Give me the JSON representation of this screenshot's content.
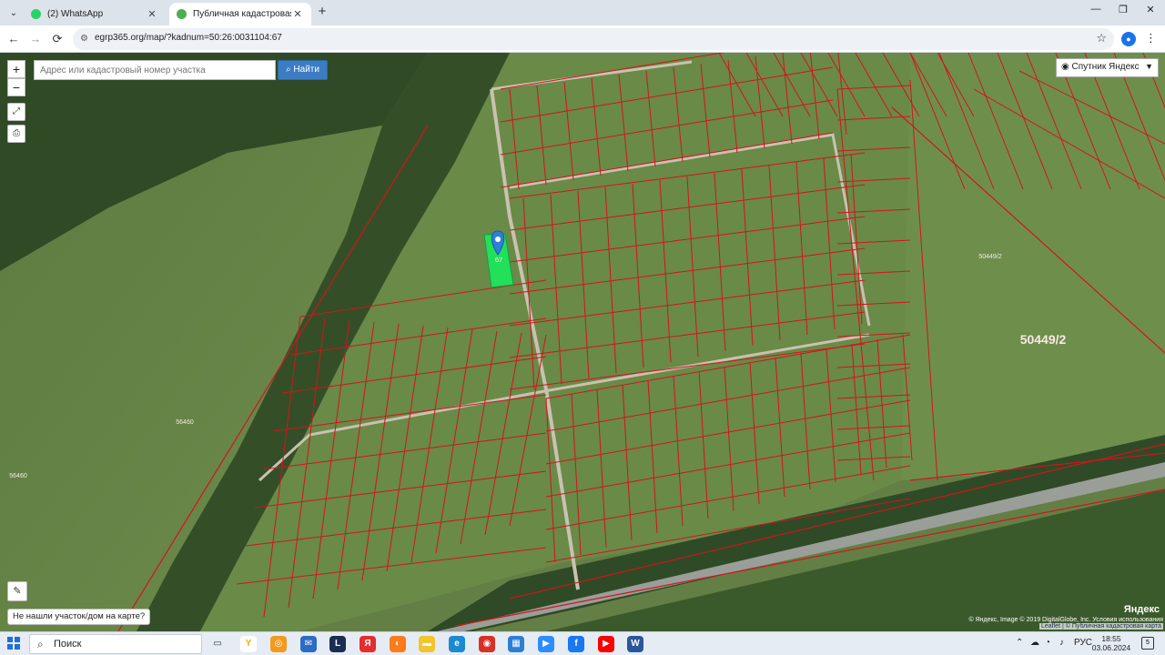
{
  "browser": {
    "tabs": [
      {
        "title": "(2) WhatsApp",
        "icon": "whatsapp-icon",
        "close": "✕"
      },
      {
        "title": "Публичная кадастровая карта",
        "icon": "site-favicon-icon",
        "close": "✕"
      }
    ],
    "new_tab": "+",
    "window": {
      "minimize": "—",
      "restore": "❐",
      "close": "✕"
    },
    "url": "egrp365.org/map/?kadnum=50:26:0031104:67",
    "nav": {
      "back": "←",
      "forward": "→",
      "reload": "⟳"
    }
  },
  "map": {
    "search_placeholder": "Адрес или кадастровый номер участка",
    "find_label": "Найти",
    "layer_select": "Спутник Яндекс",
    "zoom_in": "+",
    "zoom_out": "−",
    "not_found": "Не нашли участок/дом на карте?",
    "attribution_top": "© Яндекс, Image © 2019 DigitalGlobe, Inc. Условия использования",
    "attribution_bottom": "Leaflet | © Публичная кадастровая карта",
    "yandex_logo": "Яндекс",
    "selected_plot": "67",
    "cadastral_labels": [
      "50449/2",
      "56460"
    ],
    "highlight_color": "#22e05a",
    "boundary_color": "#d2141e"
  },
  "taskbar": {
    "search": "Поиск",
    "lang": "РУС",
    "time": "18:55",
    "date": "03.06.2024",
    "notifications": "5"
  }
}
